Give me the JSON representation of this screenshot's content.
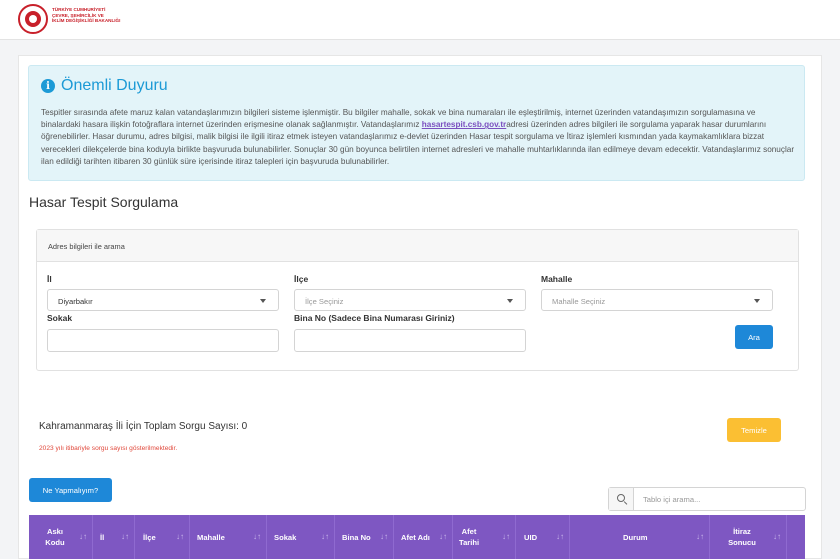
{
  "header": {
    "logo_text": [
      "TÜRKİYE CUMHURİYETİ",
      "ÇEVRE, ŞEHİRCİLİK VE",
      "İKLİM DEĞİŞİKLİĞİ BAKANLIĞI"
    ]
  },
  "notice": {
    "title": "Önemli Duyuru",
    "body_1": "Tespitler sırasında afete maruz kalan vatandaşlarımızın bilgileri sisteme işlenmiştir. Bu bilgiler mahalle, sokak ve bina numaraları ile eşleştirilmiş, internet üzerinden vatandaşımızın sorgulamasına ve binalardaki hasara ilişkin fotoğraflara internet üzerinden erişmesine olanak sağlanmıştır. Vatandaşlarımız ",
    "link": "hasartespit.csb.gov.tr",
    "body_2": "adresi üzerinden adres bilgileri ile sorgulama yaparak hasar durumlarını öğrenebilirler. Hasar durumu, adres bilgisi, malik bilgisi ile ilgili itiraz etmek isteyen vatandaşlarımız e-devlet üzerinden Hasar tespit sorgulama ve İtiraz işlemleri kısmından yada kaymakamlıklara bizzat verecekleri dilekçelerde bina koduyla birlikte başvuruda bulunabilirler. Sonuçlar 30 gün boyunca belirtilen internet adresleri ve mahalle muhtarlıklarında ilan edilmeye devam edecektir. Vatandaşlarımız sonuçlar ilan edildiği tarihten itibaren 30 günlük süre içerisinde itiraz talepleri için başvuruda bulunabilirler."
  },
  "page_title": "Hasar Tespit Sorgulama",
  "search": {
    "heading": "Adres bilgileri ile arama",
    "il_label": "İl",
    "il_value": "Diyarbakır",
    "ilce_label": "İlçe",
    "ilce_placeholder": "İlçe Seçiniz",
    "mahalle_label": "Mahalle",
    "mahalle_placeholder": "Mahalle Seçiniz",
    "sokak_label": "Sokak",
    "sokak_value": "",
    "bina_label": "Bina No (Sadece Bina Numarası Giriniz)",
    "bina_value": "",
    "submit_label": "Ara"
  },
  "results": {
    "count_text": "Kahramanmaraş İli İçin Toplam Sorgu Sayısı: 0",
    "warning": "2023 yılı itibariyle sorgu sayısı gösterilmektedir.",
    "clear_label": "Temizle",
    "help_label": "Ne Yapmalıyım?",
    "table_search_placeholder": "Tablo içi arama..."
  },
  "table": {
    "columns": [
      {
        "line1": "Askı",
        "line2": "Kodu"
      },
      {
        "line1": "İl",
        "line2": ""
      },
      {
        "line1": "İlçe",
        "line2": ""
      },
      {
        "line1": "Mahalle",
        "line2": ""
      },
      {
        "line1": "Sokak",
        "line2": ""
      },
      {
        "line1": "Bina No",
        "line2": ""
      },
      {
        "line1": "Afet Adı",
        "line2": ""
      },
      {
        "line1": "Afet",
        "line2": "Tarihi"
      },
      {
        "line1": "UID",
        "line2": ""
      },
      {
        "line1": "Durum",
        "line2": ""
      },
      {
        "line1": "İtiraz",
        "line2": "Sonucu"
      }
    ],
    "sort_glyph": "↓↑"
  },
  "colors": {
    "primary": "#1e88d8",
    "warning_button": "#fbbf33",
    "table_header": "#7e57c2",
    "notice_bg": "#e3f4f9",
    "notice_title": "#1c9ad6",
    "error_text": "#e0483b",
    "brand_red": "#c8202a"
  }
}
